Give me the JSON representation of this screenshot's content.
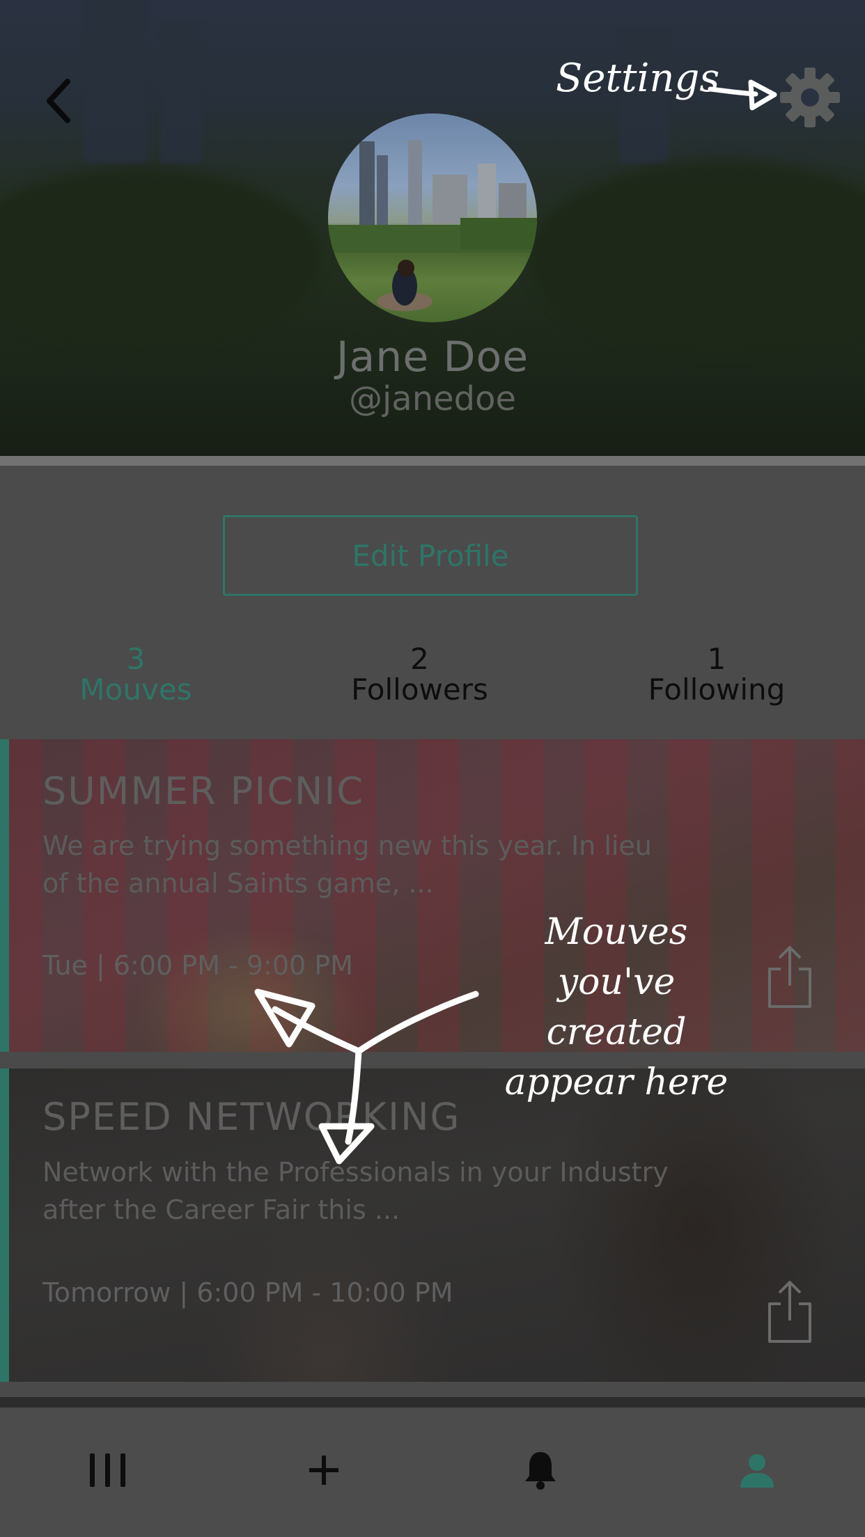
{
  "header": {
    "name": "Jane Doe",
    "handle": "@janedoe"
  },
  "profile": {
    "edit_button_label": "Edit Profile",
    "stats": {
      "mouves": {
        "count": "3",
        "label": "Mouves"
      },
      "followers": {
        "count": "2",
        "label": "Followers"
      },
      "following": {
        "count": "1",
        "label": "Following"
      }
    }
  },
  "mouves": [
    {
      "title": "SUMMER PICNIC",
      "description": "We are trying something new this year.  In lieu of the annual Saints game, ...",
      "time": "Tue | 6:00 PM - 9:00 PM"
    },
    {
      "title": "SPEED NETWORKING",
      "description": "Network with the Professionals in your Industry after the Career Fair this ...",
      "time": "Tomorrow | 6:00 PM - 10:00 PM"
    }
  ],
  "annotations": {
    "settings_note": "Settings",
    "mouves_note": "Mouves you've created appear here"
  },
  "nav": {
    "items": [
      {
        "icon": "feed-icon"
      },
      {
        "icon": "plus-icon"
      },
      {
        "icon": "bell-icon"
      },
      {
        "icon": "person-icon",
        "active": true
      }
    ]
  },
  "colors": {
    "accent": "#2e7567",
    "overlay_dim": "#4a4a4a",
    "annotation": "#ffffff"
  }
}
